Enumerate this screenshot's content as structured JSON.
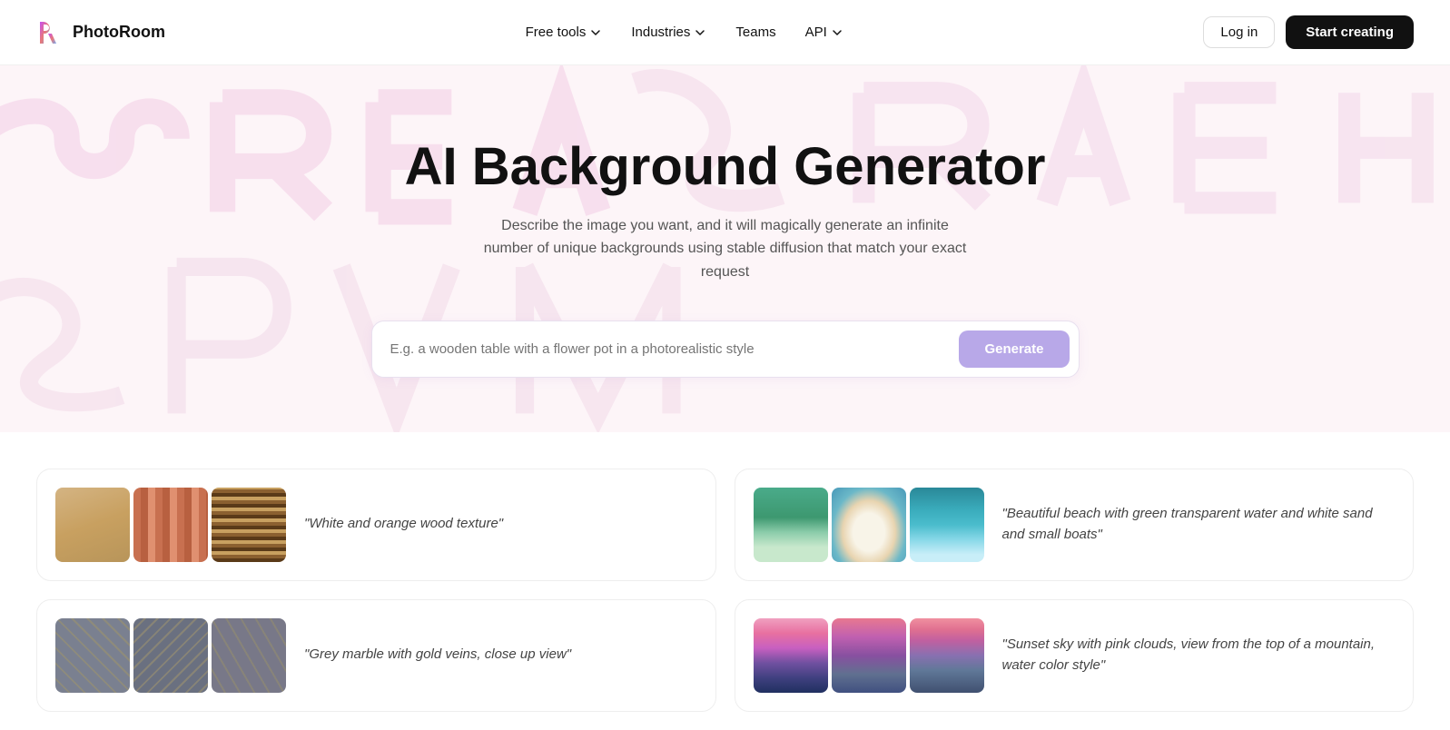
{
  "nav": {
    "logo_text": "PhotoRoom",
    "links": [
      {
        "label": "Free tools",
        "has_dropdown": true
      },
      {
        "label": "Industries",
        "has_dropdown": true
      },
      {
        "label": "Teams",
        "has_dropdown": false
      },
      {
        "label": "API",
        "has_dropdown": true
      }
    ],
    "login_label": "Log in",
    "start_label": "Start creating"
  },
  "hero": {
    "title": "AI Background Generator",
    "subtitle": "Describe the image you want, and it will magically generate an infinite number of unique backgrounds using stable diffusion that match your exact request",
    "search_placeholder": "E.g. a wooden table with a flower pot in a photorealistic style",
    "generate_label": "Generate"
  },
  "cards": [
    {
      "label": "\"White and orange wood texture\"",
      "images": [
        "wood1",
        "wood2",
        "wood3"
      ]
    },
    {
      "label": "\"Beautiful beach with green transparent water and white sand and small boats\"",
      "images": [
        "beach1",
        "beach2",
        "beach3"
      ]
    },
    {
      "label": "\"Grey marble with gold veins, close up view\"",
      "images": [
        "marble1",
        "marble2",
        "marble3"
      ]
    },
    {
      "label": "\"Sunset sky with pink clouds, view from the top of a mountain, water color style\"",
      "images": [
        "sunset1",
        "sunset2",
        "sunset3"
      ]
    }
  ]
}
